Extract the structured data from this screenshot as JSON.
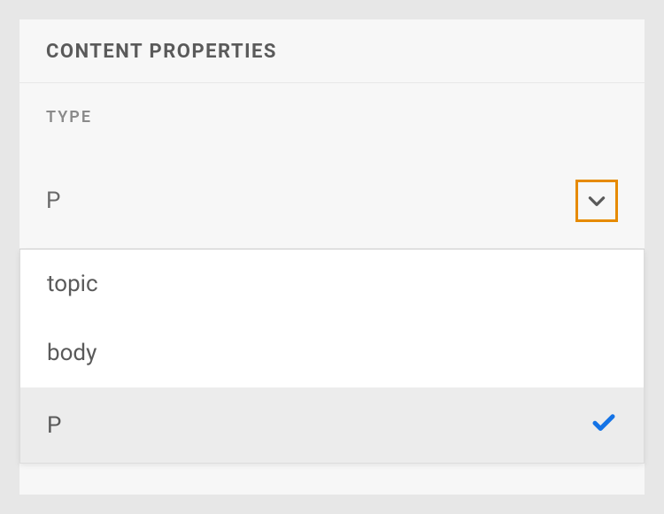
{
  "panel": {
    "title": "CONTENT PROPERTIES"
  },
  "type_section": {
    "label": "TYPE",
    "selected_value": "P",
    "options": [
      {
        "label": "topic",
        "selected": false
      },
      {
        "label": "body",
        "selected": false
      },
      {
        "label": "P",
        "selected": true
      }
    ]
  },
  "icons": {
    "chevron_down": "chevron-down-icon",
    "check": "check-icon"
  },
  "colors": {
    "highlight_border": "#e68a00",
    "check_color": "#1473e6",
    "panel_bg": "#f7f7f7",
    "page_bg": "#e7e7e7"
  }
}
